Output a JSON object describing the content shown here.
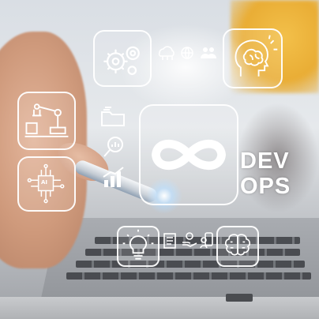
{
  "scene": {
    "wordmark": {
      "line1": "DEV",
      "line2": "OPS"
    },
    "ai_chip_text": "AI"
  },
  "icons": [
    "gears-icon",
    "cloud-network-icon",
    "globe-refresh-icon",
    "people-icon",
    "brain-head-icon",
    "robot-arm-icon",
    "folder-icon",
    "analytics-search-icon",
    "bar-chart-icon",
    "infinity-icon",
    "ai-chip-icon",
    "lightbulb-icon",
    "document-icon",
    "hand-coin-icon",
    "person-phone-icon",
    "brain-circuit-icon"
  ]
}
